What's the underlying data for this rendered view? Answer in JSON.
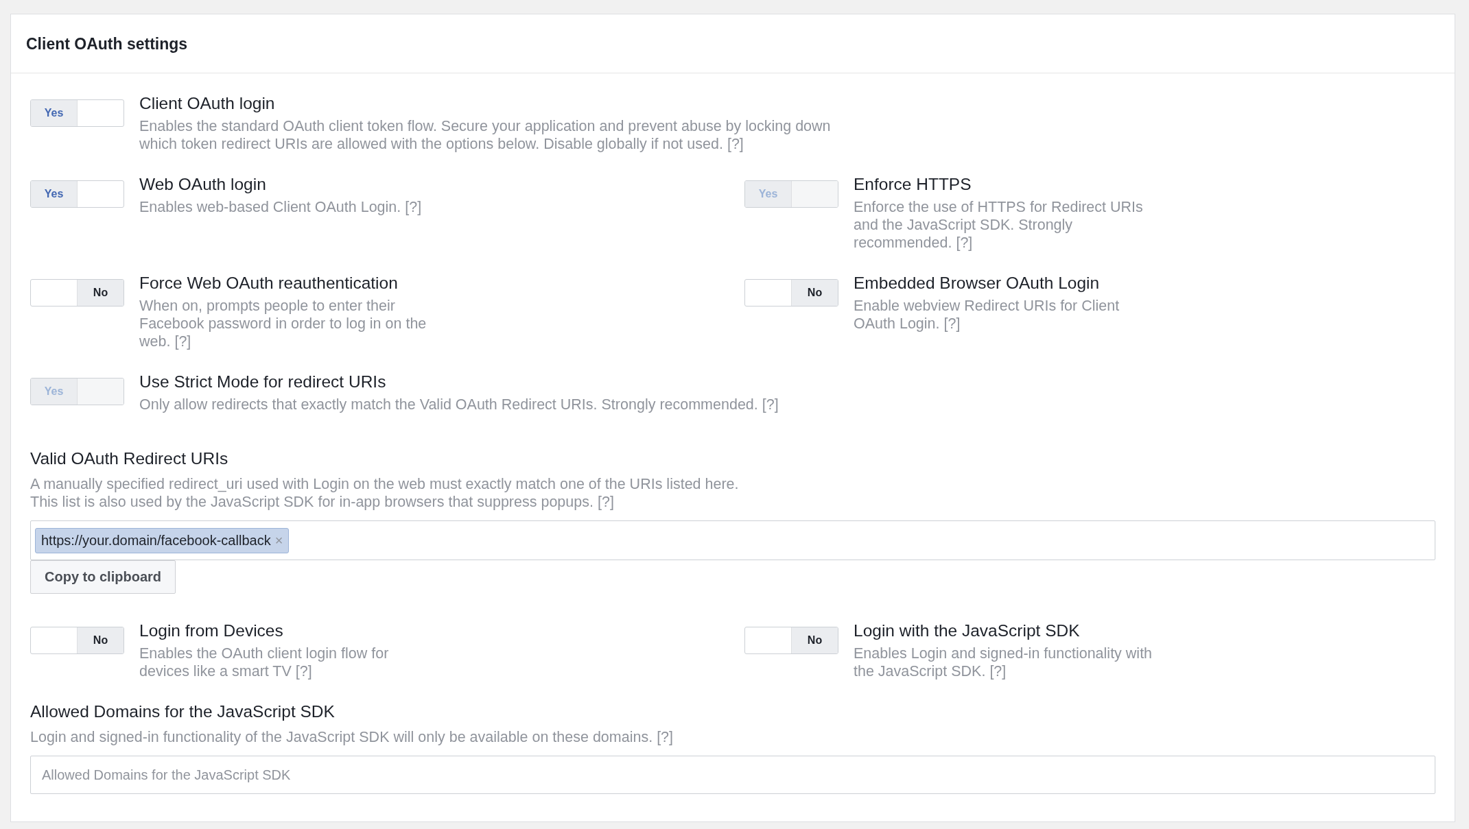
{
  "panel": {
    "title": "Client OAuth settings"
  },
  "rows": [
    {
      "left": {
        "title": "Client OAuth login",
        "description": "Enables the standard OAuth client token flow. Secure your application and prevent abuse by locking down which token redirect URIs are allowed with the options below. Disable globally if not used.",
        "help": "[?]",
        "toggle": {
          "label": "Yes",
          "on": true,
          "disabled": false
        }
      }
    },
    {
      "left": {
        "title": "Web OAuth login",
        "description": "Enables web-based Client OAuth Login.",
        "help": "[?]",
        "toggle": {
          "label": "Yes",
          "on": true,
          "disabled": false
        }
      },
      "right": {
        "title": "Enforce HTTPS",
        "description": "Enforce the use of HTTPS for Redirect URIs and the JavaScript SDK. Strongly recommended.",
        "help": "[?]",
        "toggle": {
          "label": "Yes",
          "on": true,
          "disabled": true
        }
      }
    },
    {
      "left": {
        "title": "Force Web OAuth reauthentication",
        "description": "When on, prompts people to enter their Facebook password in order to log in on the web.",
        "help": "[?]",
        "toggle": {
          "label": "No",
          "on": false,
          "disabled": false
        }
      },
      "right": {
        "title": "Embedded Browser OAuth Login",
        "description": "Enable webview Redirect URIs for Client OAuth Login.",
        "help": "[?]",
        "toggle": {
          "label": "No",
          "on": false,
          "disabled": false
        }
      }
    },
    {
      "left": {
        "title": "Use Strict Mode for redirect URIs",
        "description": "Only allow redirects that exactly match the Valid OAuth Redirect URIs. Strongly recommended.",
        "help": "[?]",
        "toggle": {
          "label": "Yes",
          "on": true,
          "disabled": true
        }
      }
    }
  ],
  "redirect_uris": {
    "title": "Valid OAuth Redirect URIs",
    "description_lines": [
      "A manually specified redirect_uri used with Login on the web must exactly match one of the URIs listed here.",
      "This list is also used by the JavaScript SDK for in-app browsers that suppress popups."
    ],
    "help": "[?]",
    "tokens": [
      {
        "value": "https://your.domain/facebook-callback",
        "remove": "×"
      }
    ],
    "copy_button": "Copy to clipboard"
  },
  "rows_2": [
    {
      "left": {
        "title": "Login from Devices",
        "description": "Enables the OAuth client login flow for devices like a smart TV",
        "help": "[?]",
        "toggle": {
          "label": "No",
          "on": false,
          "disabled": false
        }
      },
      "right": {
        "title": "Login with the JavaScript SDK",
        "description": "Enables Login and signed-in functionality with the JavaScript SDK.",
        "help": "[?]",
        "toggle": {
          "label": "No",
          "on": false,
          "disabled": false
        }
      }
    }
  ],
  "allowed_domains": {
    "title": "Allowed Domains for the JavaScript SDK",
    "description": "Login and signed-in functionality of the JavaScript SDK will only be available on these domains.",
    "help": "[?]",
    "placeholder": "Allowed Domains for the JavaScript SDK"
  }
}
